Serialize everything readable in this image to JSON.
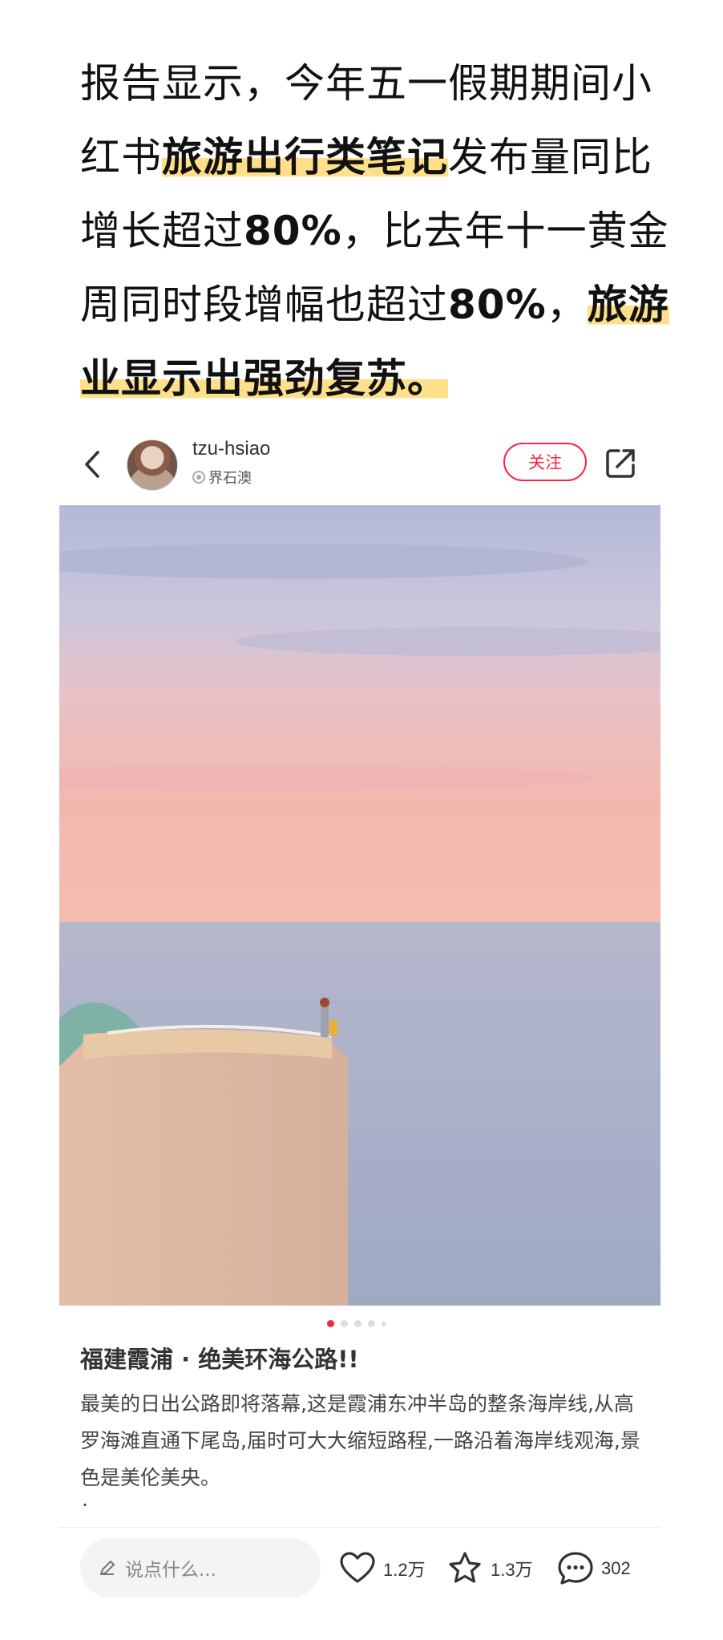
{
  "headline": {
    "l1": "报告显示，今年五一假期期间小",
    "l2a": "红书",
    "l2b": "旅游出行类笔记",
    "l2c": "发布量同比",
    "l3a": "增长超过",
    "l3b": "80%",
    "l3c": "，比去年十一黄金",
    "l4a": "周同时段增幅也超过",
    "l4b": "80%",
    "l4c": "，",
    "l4d": "旅游",
    "l5": "业显示出强劲复苏。"
  },
  "post": {
    "username": "tzu-hsiao",
    "location": "界石澳",
    "follow_label": "关注",
    "title": "福建霞浦 · 绝美环海公路!!",
    "description": "最美的日出公路即将落幕,这是霞浦东冲半岛的整条海岸线,从高罗海滩直通下尾岛,届时可大大缩短路程,一路沿着海岸线观海,景色是美伦美央。",
    "trailing_dot": "·",
    "carousel": {
      "total": 5,
      "active": 1
    }
  },
  "bottom_bar": {
    "comment_placeholder": "说点什么...",
    "likes": "1.2万",
    "collects": "1.3万",
    "comments": "302"
  },
  "icons": {
    "back": "chevron-left-icon",
    "share": "share-icon",
    "location": "location-pin-icon",
    "pencil": "pencil-icon",
    "like": "heart-icon",
    "collect": "star-icon",
    "comment": "chat-bubble-icon"
  },
  "colors": {
    "accent": "#ff2442",
    "highlight": "#ffe08a"
  }
}
